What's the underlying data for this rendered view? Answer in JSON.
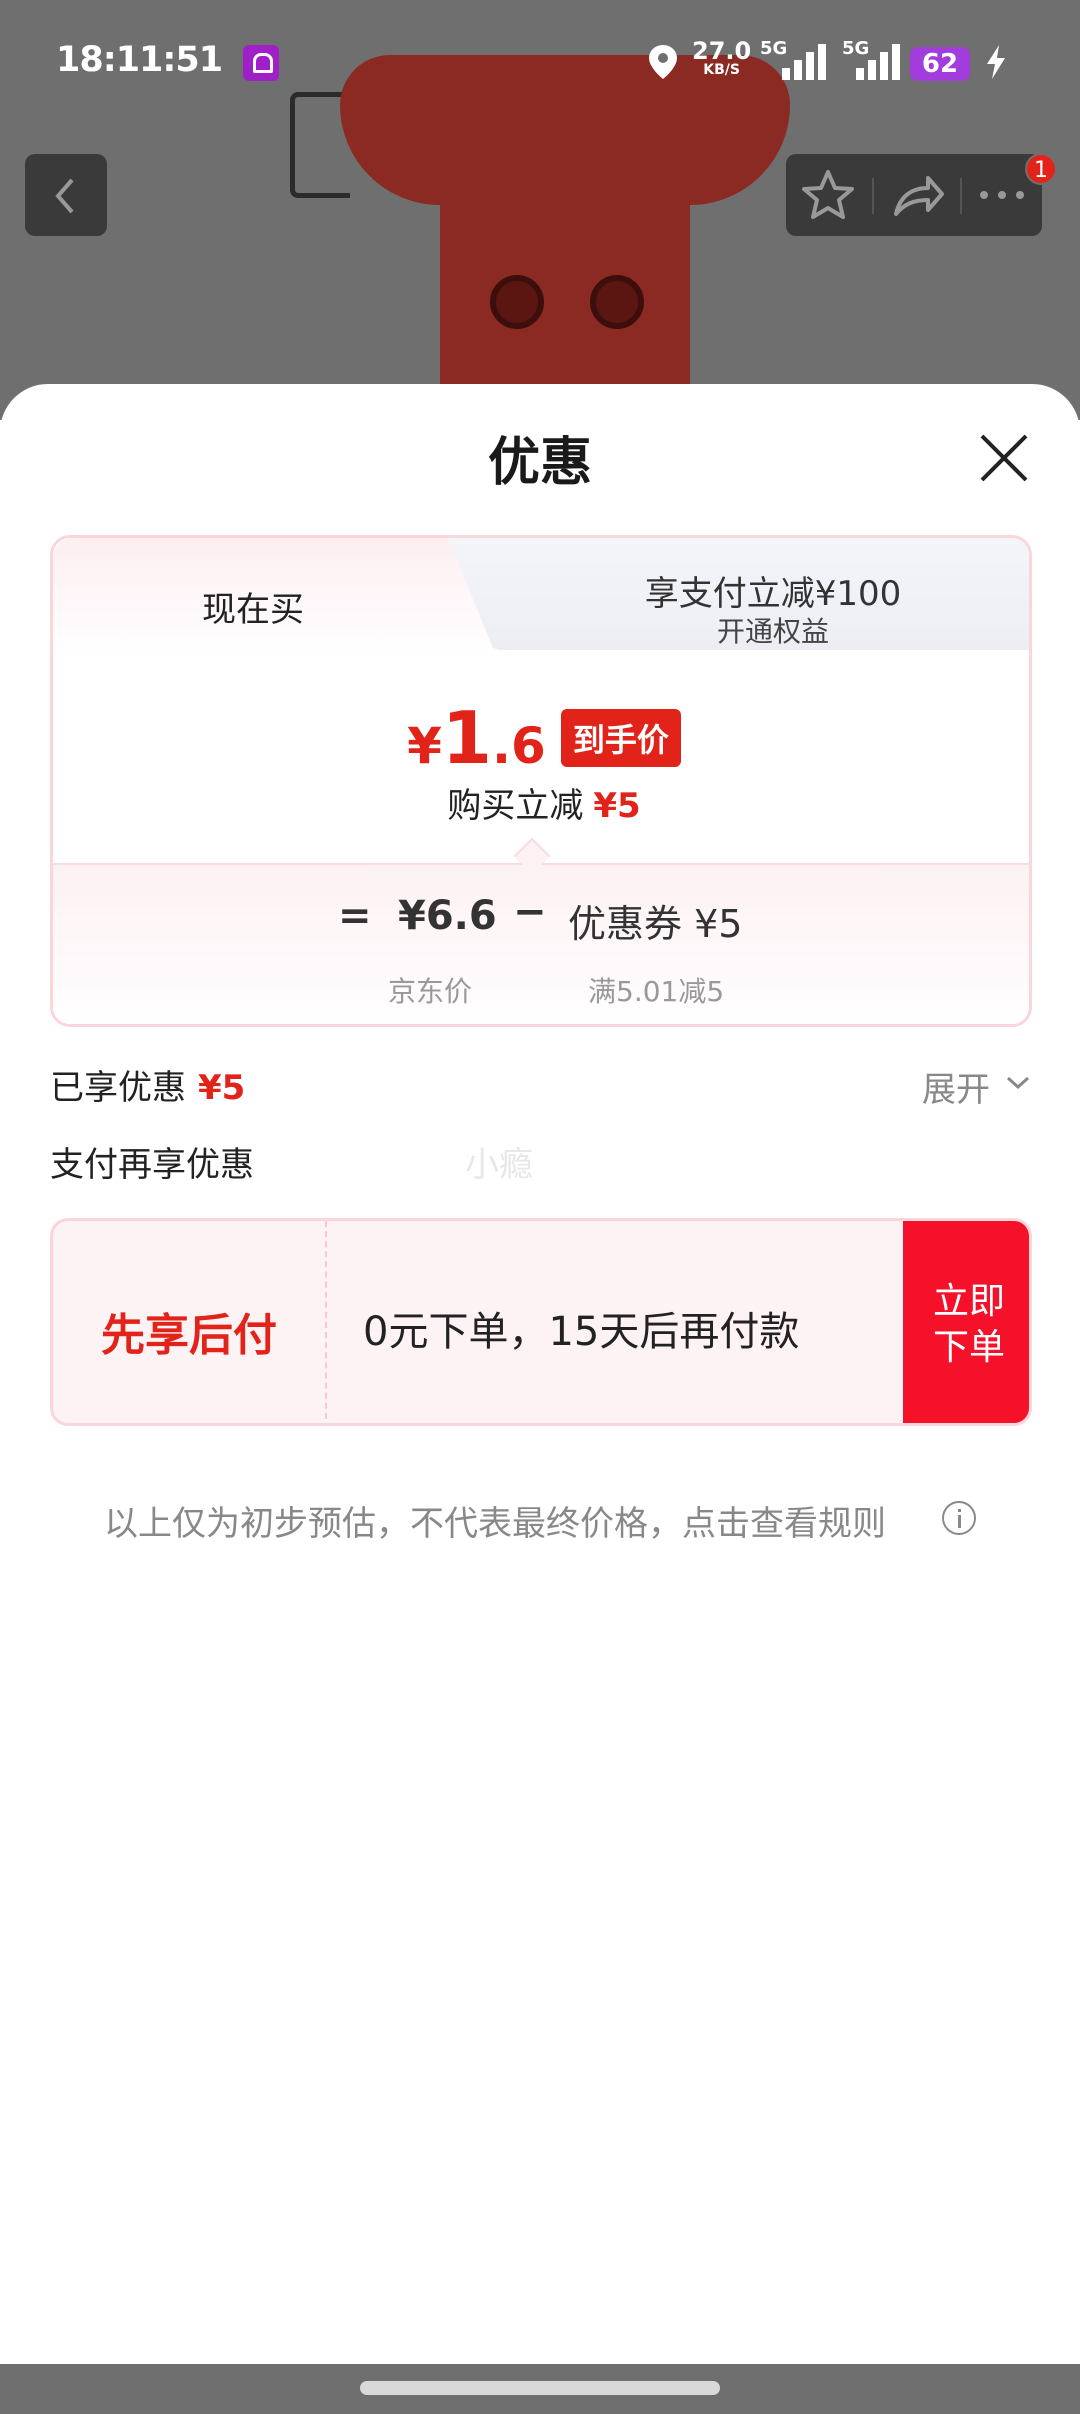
{
  "status_bar": {
    "time": "18:11:51",
    "speed_value": "27.0",
    "speed_unit": "KB/S",
    "network1": "5G",
    "network2": "5G",
    "battery": "62"
  },
  "nav": {
    "badge_count": "1"
  },
  "sheet": {
    "title": "优惠",
    "tabs": {
      "active": "现在买",
      "other_title": "享支付立减¥100",
      "other_subtitle": "开通权益"
    },
    "price": {
      "currency": "¥",
      "integer": "1",
      "decimal": ".6",
      "tag": "到手价"
    },
    "reduce": {
      "label": "购买立减",
      "amount": "¥5"
    },
    "calc": {
      "equals": "=",
      "jd_price": "¥6.6",
      "minus": "−",
      "coupon": "优惠券 ¥5",
      "jd_price_label": "京东价",
      "coupon_rule": "满5.01减5"
    },
    "enjoyed": {
      "label": "已享优惠",
      "amount": "¥5"
    },
    "expand_label": "展开",
    "pay_more_label": "支付再享优惠",
    "watermark": "小瘾",
    "bnpl": {
      "title": "先享后付",
      "desc": "0元下单，15天后再付款",
      "button_line1": "立即",
      "button_line2": "下单"
    },
    "disclaimer": "以上仅为初步预估，不代表最终价格，点击查看规则"
  },
  "colors": {
    "accent_red": "#e2231a",
    "button_red": "#f5112a",
    "card_border": "#f9d6dc"
  },
  "icons": [
    "bell-icon",
    "location-icon",
    "signal-icon",
    "battery-icon",
    "charging-icon",
    "back-icon",
    "star-icon",
    "share-icon",
    "more-icon",
    "close-icon",
    "chevron-down-icon",
    "info-icon"
  ]
}
